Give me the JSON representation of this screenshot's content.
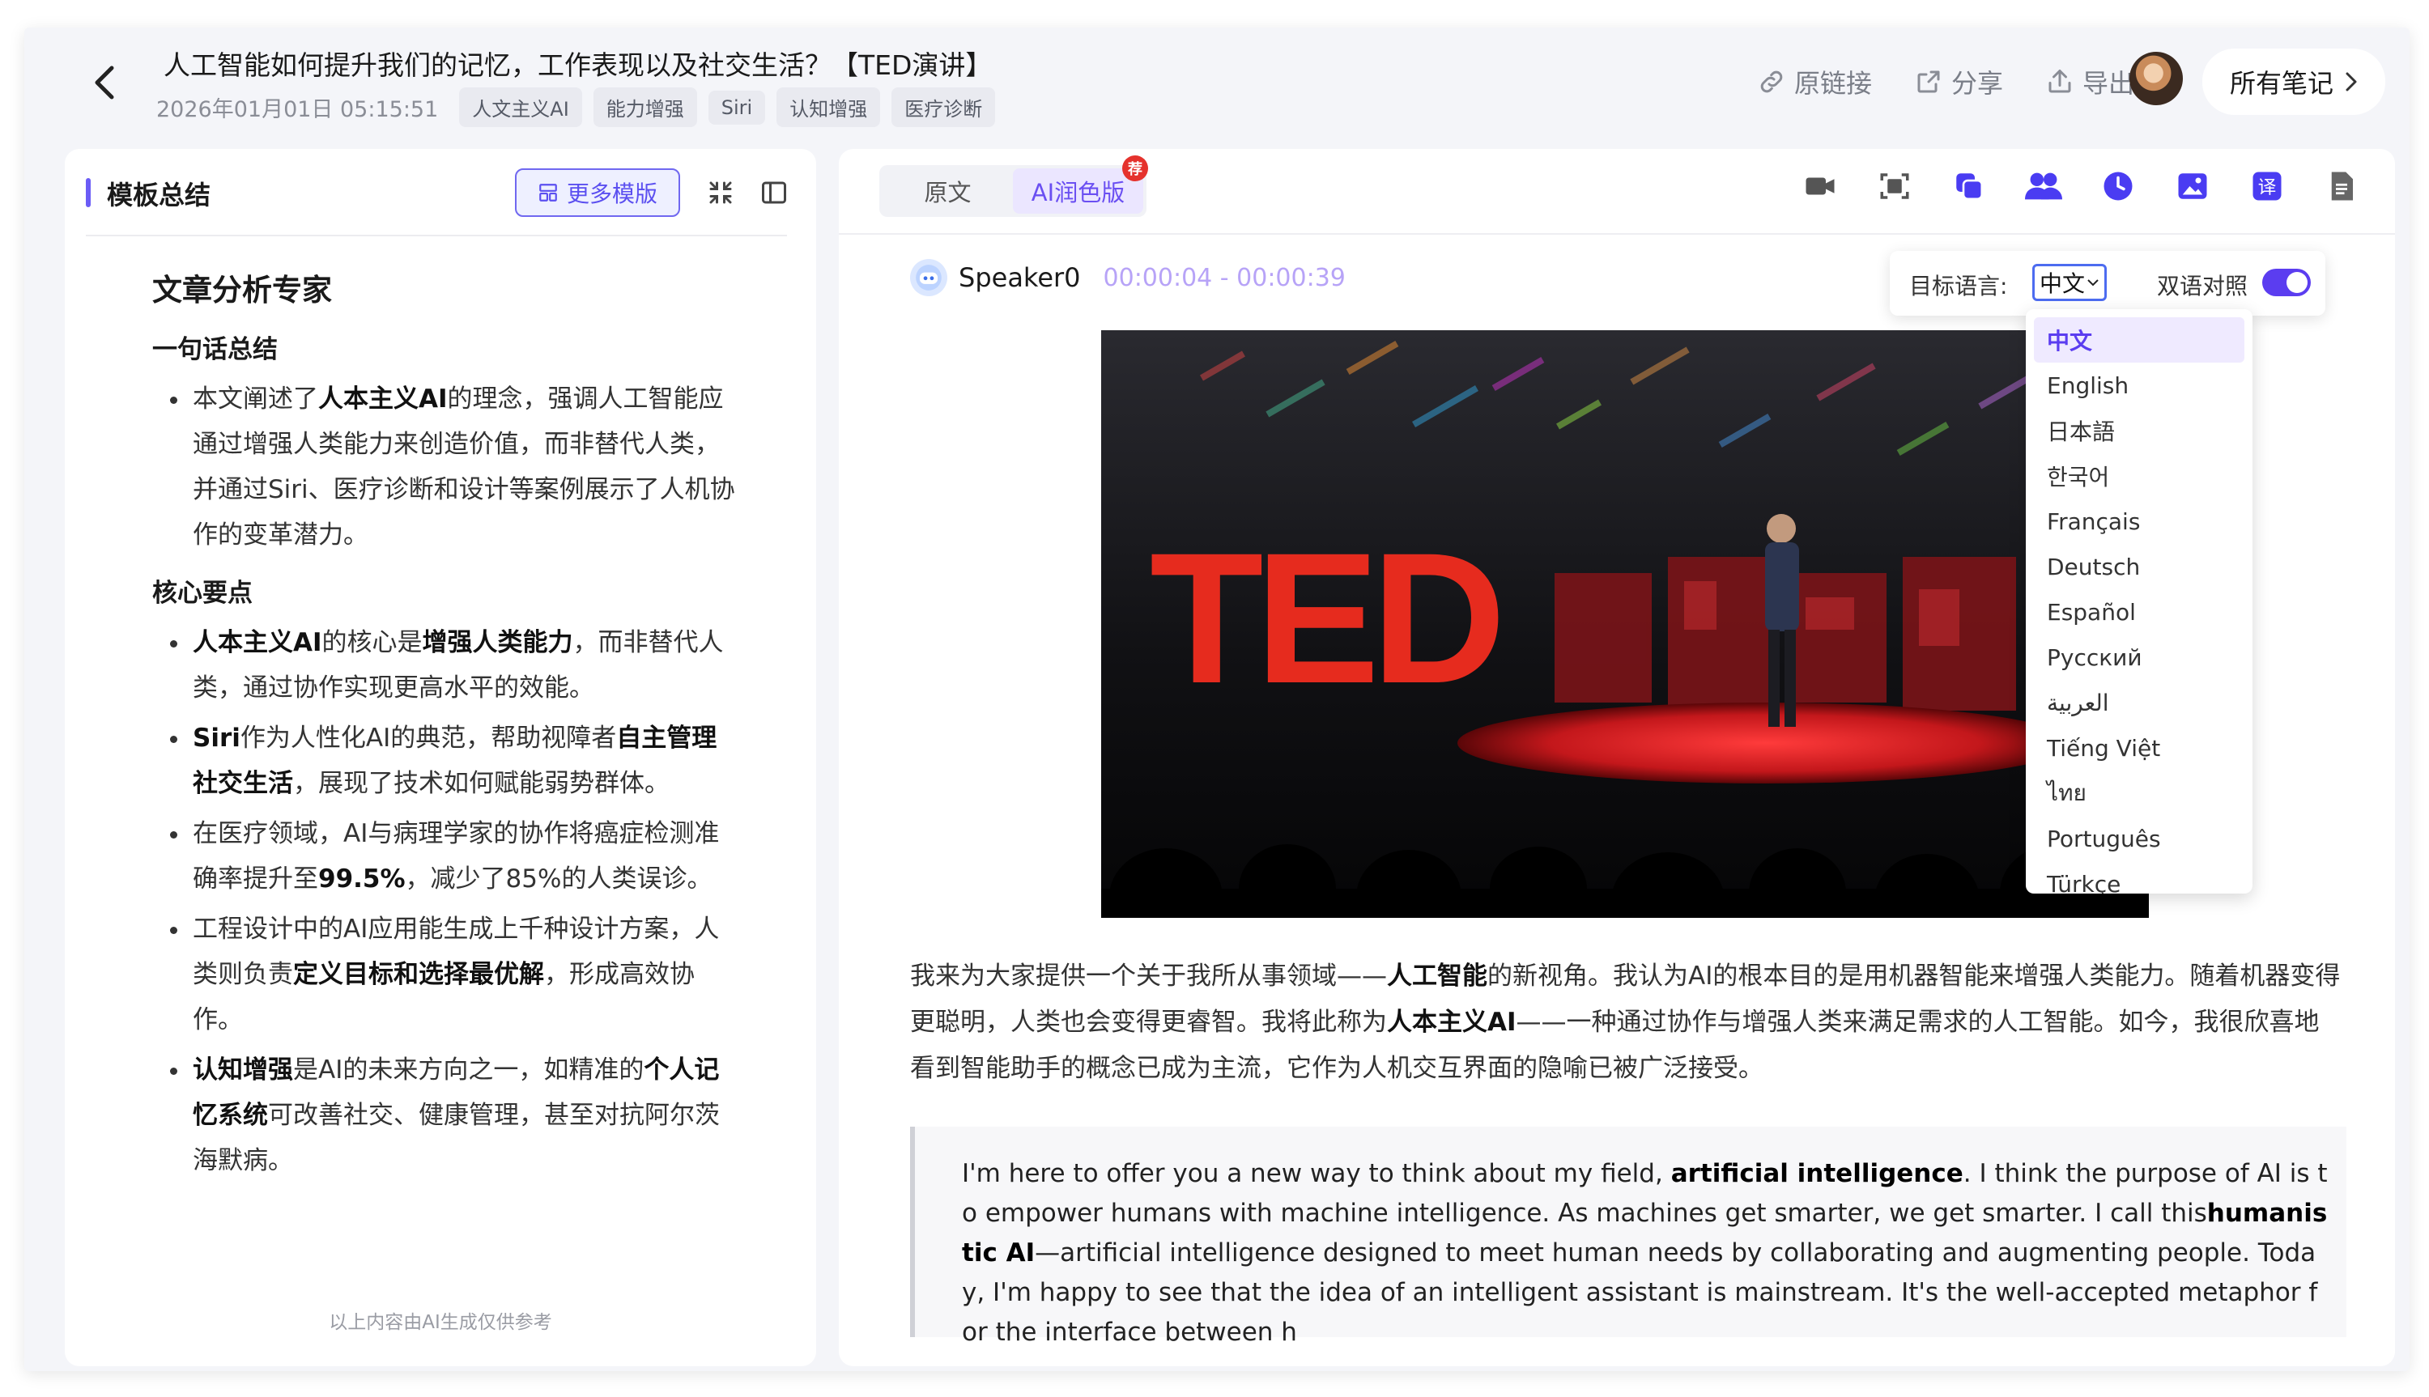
{
  "header": {
    "title": "人工智能如何提升我们的记忆，工作表现以及社交生活？【TED演讲】",
    "date": "2026年01月01日 05:15:51",
    "tags": [
      "人文主义AI",
      "能力增强",
      "Siri",
      "认知增强",
      "医疗诊断"
    ],
    "actions": {
      "link": "原链接",
      "share": "分享",
      "export": "导出"
    },
    "all_notes": "所有笔记"
  },
  "left": {
    "title": "模板总结",
    "more_templates": "更多模版",
    "doc_title": "文章分析专家",
    "sec1_title": "一句话总结",
    "summary_parts": [
      "本文阐述了",
      "人本主义AI",
      "的理念，强调人工智能应通过增强人类能力来创造价值，而非替代人类，并通过Siri、医疗诊断和设计等案例展示了人机协作的变革潜力。"
    ],
    "sec2_title": "核心要点",
    "p1": [
      "人本主义AI",
      "的核心是",
      "增强人类能力",
      "，而非替代人类，通过协作实现更高水平的效能。"
    ],
    "p2": [
      "Siri",
      "作为人性化AI的典范，帮助视障者",
      "自主管理社交生活",
      "，展现了技术如何赋能弱势群体。"
    ],
    "p3": [
      "在医疗领域，AI与病理学家的协作将癌症检测准确率提升至",
      "99.5%",
      "，减少了85%的人类误诊。"
    ],
    "p4": [
      "工程设计中的AI应用能生成上千种设计方案，人类则负责",
      "定义目标和选择最优解",
      "，形成高效协作。"
    ],
    "p5": [
      "认知增强",
      "是AI的未来方向之一，如精准的",
      "个人记忆系统",
      "可改善社交、健康管理，甚至对抗阿尔茨海默病。"
    ],
    "disclaimer": "以上内容由AI生成仅供参考"
  },
  "right": {
    "tabs": [
      "原文",
      "AI润色版"
    ],
    "badge": "荐",
    "speaker": "Speaker0",
    "time_range": "00:00:04 - 00:00:39",
    "video_logo": "TED",
    "cn_parts": [
      "我来为大家提供一个关于我所从事领域——",
      "人工智能",
      "的新视角。我认为AI的根本目的是用机器智能来增强人类能力。随着机器变得更聪明，人类也会变得更睿智。我将此称为",
      "人本主义AI",
      "——一种通过协作与增强人类来满足需求的人工智能。如今，我很欣喜地看到智能助手的概念已成为主流，它作为人机交互界面的隐喻已被广泛接受。"
    ],
    "en_parts": [
      "I'm here to offer you a new way to think about my field, ",
      "artificial intelligence",
      ". I think the purpose of AI is to empower humans with machine intelligence. As machines get smarter, we get smarter. I call this",
      "humanistic AI",
      "—artificial intelligence designed to meet human needs by collaborating and augmenting people. Today, I'm happy to see that the idea of an intelligent assistant is mainstream. It's the well-accepted metaphor for the interface between h"
    ]
  },
  "lang": {
    "target_label": "目标语言:",
    "selected": "中文",
    "bilingual_label": "双语对照",
    "bilingual_on": true,
    "options": [
      "中文",
      "English",
      "日本語",
      "한국어",
      "Français",
      "Deutsch",
      "Español",
      "Русский",
      "العربية",
      "Tiếng Việt",
      "ไทย",
      "Português",
      "Türkçe"
    ]
  },
  "colors": {
    "accent": "#5b3df0",
    "tool_blue": "#3d3df0",
    "ted_red": "#e62b1e"
  }
}
